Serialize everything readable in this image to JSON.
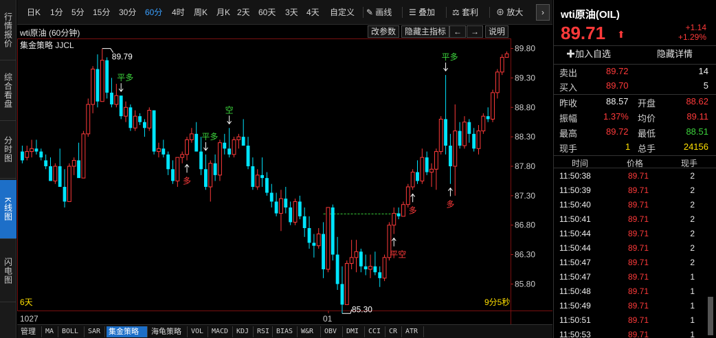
{
  "rail": {
    "tabs": [
      "行情报价",
      "综合看盘",
      "分时图",
      "K线图",
      "闪电图"
    ],
    "active": 3
  },
  "toolbar": {
    "periods": [
      "日K",
      "1分",
      "5分",
      "15分",
      "30分",
      "60分",
      "4时",
      "周K",
      "月K",
      "2天",
      "60天",
      "3天",
      "4天",
      "自定义"
    ],
    "active_period": "60分",
    "draw_label": "画线",
    "overlay_label": "叠加",
    "arbitrage_label": "套利",
    "zoom_label": "放大",
    "arrow": "›"
  },
  "chart_header": {
    "title": "wti原油 (60分钟)",
    "btn_params": "改参数",
    "btn_hide": "隐藏主指标",
    "btn_left": "←",
    "btn_right": "→",
    "btn_help": "说明",
    "strategy": "集金策略 JJCL"
  },
  "chart_data": {
    "type": "candlestick",
    "ylim": [
      85.35,
      89.97
    ],
    "yticks": [
      "89.80",
      "89.30",
      "88.80",
      "88.30",
      "87.80",
      "87.30",
      "86.80",
      "86.30",
      "85.80"
    ],
    "xlabels": [
      "1027",
      "01"
    ],
    "max_label": "89.79",
    "min_label": "85.30",
    "period_label": "6天",
    "countdown": "9分5秒",
    "guide_level": 86.99,
    "ohlc": [
      [
        88.05,
        88.15,
        87.85,
        87.9
      ],
      [
        87.95,
        88.15,
        87.9,
        88.05
      ],
      [
        88.05,
        88.25,
        87.95,
        88.1
      ],
      [
        88.1,
        88.25,
        88.0,
        88.05
      ],
      [
        88.05,
        88.1,
        87.9,
        87.95
      ],
      [
        87.9,
        88.0,
        87.75,
        87.8
      ],
      [
        87.8,
        87.95,
        87.55,
        87.55
      ],
      [
        87.55,
        87.85,
        87.5,
        87.8
      ],
      [
        87.8,
        88.1,
        87.45,
        87.45
      ],
      [
        87.45,
        87.75,
        87.1,
        87.2
      ],
      [
        87.2,
        87.85,
        87.2,
        87.8
      ],
      [
        87.8,
        87.95,
        87.65,
        87.9
      ],
      [
        87.9,
        88.2,
        87.8,
        87.6
      ],
      [
        87.6,
        88.4,
        87.6,
        88.35
      ],
      [
        88.35,
        88.95,
        88.3,
        88.85
      ],
      [
        88.85,
        89.5,
        88.7,
        89.45
      ],
      [
        89.45,
        89.7,
        88.8,
        88.9
      ],
      [
        88.9,
        89.8,
        88.9,
        89.6
      ],
      [
        89.6,
        89.65,
        88.95,
        89.05
      ],
      [
        89.05,
        89.3,
        88.8,
        88.85
      ],
      [
        88.85,
        89.2,
        88.8,
        89.0
      ],
      [
        89.0,
        89.0,
        88.6,
        88.65
      ],
      [
        88.65,
        88.9,
        88.55,
        88.8
      ],
      [
        88.8,
        88.85,
        88.4,
        88.45
      ],
      [
        88.45,
        88.75,
        88.4,
        88.65
      ],
      [
        88.65,
        88.7,
        88.5,
        88.55
      ],
      [
        88.55,
        88.6,
        88.3,
        88.45
      ],
      [
        88.45,
        88.8,
        88.4,
        88.75
      ],
      [
        88.75,
        88.75,
        88.0,
        88.05
      ],
      [
        88.05,
        88.2,
        87.95,
        88.1
      ],
      [
        88.1,
        88.25,
        87.95,
        88.0
      ],
      [
        88.0,
        88.05,
        87.65,
        87.75
      ],
      [
        87.75,
        87.9,
        87.5,
        87.55
      ],
      [
        87.55,
        87.95,
        87.45,
        87.95
      ],
      [
        87.95,
        88.05,
        87.85,
        88.0
      ],
      [
        88.0,
        88.3,
        87.9,
        88.25
      ],
      [
        88.25,
        88.45,
        88.2,
        88.35
      ],
      [
        88.35,
        88.55,
        88.05,
        88.05
      ],
      [
        88.05,
        88.3,
        87.65,
        87.75
      ],
      [
        87.75,
        88.0,
        87.4,
        87.45
      ],
      [
        87.45,
        87.9,
        87.2,
        87.85
      ],
      [
        87.85,
        88.0,
        87.55,
        87.65
      ],
      [
        87.65,
        88.25,
        87.55,
        88.2
      ],
      [
        88.2,
        88.35,
        88.0,
        88.1
      ],
      [
        88.1,
        88.45,
        87.95,
        88.0
      ],
      [
        88.0,
        88.3,
        87.95,
        88.25
      ],
      [
        88.25,
        88.35,
        88.1,
        88.3
      ],
      [
        88.3,
        88.6,
        88.2,
        88.15
      ],
      [
        88.15,
        88.3,
        87.75,
        87.8
      ],
      [
        87.8,
        87.95,
        87.4,
        87.45
      ],
      [
        87.45,
        87.75,
        87.4,
        87.65
      ],
      [
        87.65,
        87.95,
        87.45,
        87.6
      ],
      [
        87.6,
        87.7,
        87.3,
        87.35
      ],
      [
        87.35,
        87.5,
        87.1,
        87.2
      ],
      [
        87.2,
        87.35,
        86.95,
        87.0
      ],
      [
        87.0,
        87.4,
        86.7,
        87.25
      ],
      [
        87.25,
        87.45,
        87.0,
        87.1
      ],
      [
        87.1,
        87.2,
        86.8,
        86.85
      ],
      [
        86.85,
        87.25,
        86.8,
        87.2
      ],
      [
        87.2,
        87.3,
        86.9,
        86.95
      ],
      [
        86.95,
        87.1,
        86.6,
        86.75
      ],
      [
        86.75,
        86.95,
        86.4,
        86.5
      ],
      [
        86.5,
        86.65,
        86.25,
        86.45
      ],
      [
        86.45,
        86.75,
        86.4,
        86.65
      ],
      [
        86.65,
        86.85,
        85.9,
        86.05
      ],
      [
        86.05,
        87.0,
        86.0,
        87.1
      ],
      [
        87.1,
        87.15,
        86.2,
        86.3
      ],
      [
        86.3,
        86.6,
        85.7,
        85.8
      ],
      [
        85.8,
        86.1,
        85.3,
        85.45
      ],
      [
        85.45,
        86.2,
        85.45,
        86.15
      ],
      [
        86.15,
        86.55,
        86.05,
        86.25
      ],
      [
        86.25,
        86.55,
        86.0,
        86.35
      ],
      [
        86.35,
        86.4,
        86.0,
        86.1
      ],
      [
        86.1,
        86.3,
        85.95,
        86.05
      ],
      [
        86.05,
        86.3,
        85.9,
        86.1
      ],
      [
        86.1,
        86.35,
        85.95,
        86.0
      ],
      [
        86.0,
        86.1,
        85.75,
        85.9
      ],
      [
        85.9,
        86.3,
        85.85,
        86.25
      ],
      [
        86.25,
        86.85,
        86.2,
        86.8
      ],
      [
        86.8,
        87.1,
        86.65,
        87.0
      ],
      [
        87.0,
        87.1,
        86.9,
        86.95
      ],
      [
        86.95,
        87.2,
        86.95,
        87.15
      ],
      [
        87.15,
        87.5,
        87.1,
        87.45
      ],
      [
        87.45,
        87.75,
        87.4,
        87.7
      ],
      [
        87.7,
        87.9,
        87.5,
        87.55
      ],
      [
        87.55,
        88.1,
        87.5,
        87.95
      ],
      [
        87.95,
        88.05,
        87.65,
        87.7
      ],
      [
        87.7,
        87.85,
        87.45,
        87.75
      ],
      [
        87.75,
        88.1,
        87.4,
        88.05
      ],
      [
        88.05,
        88.65,
        88.0,
        88.6
      ],
      [
        88.6,
        89.35,
        88.0,
        88.15
      ],
      [
        88.15,
        88.35,
        87.5,
        87.8
      ],
      [
        87.8,
        88.85,
        87.3,
        88.4
      ],
      [
        88.4,
        88.55,
        88.1,
        88.15
      ],
      [
        88.15,
        88.65,
        88.1,
        88.55
      ],
      [
        88.55,
        88.6,
        88.2,
        88.35
      ],
      [
        88.35,
        88.45,
        88.05,
        88.1
      ],
      [
        88.1,
        88.5,
        88.0,
        88.4
      ],
      [
        88.4,
        88.7,
        88.35,
        88.65
      ],
      [
        88.65,
        88.8,
        88.55,
        88.6
      ],
      [
        88.6,
        89.1,
        88.55,
        89.05
      ],
      [
        89.05,
        89.45,
        88.95,
        89.4
      ],
      [
        89.4,
        89.7,
        89.35,
        89.65
      ],
      [
        89.65,
        89.75,
        89.65,
        89.71
      ]
    ],
    "signals": [
      {
        "i": 21,
        "label": "平多",
        "dir": "down",
        "color": "#3cd43c",
        "pos": "above"
      },
      {
        "i": 35,
        "label": "多",
        "dir": "up",
        "color": "#ff3a3a",
        "pos": "below"
      },
      {
        "i": 39,
        "label": "平多",
        "dir": "down",
        "color": "#3cd43c",
        "pos": "above"
      },
      {
        "i": 44,
        "label": "空",
        "dir": "down",
        "color": "#3cd43c",
        "pos": "above"
      },
      {
        "i": 79,
        "label": "平空",
        "dir": "up",
        "color": "#ff3a3a",
        "pos": "below"
      },
      {
        "i": 83,
        "label": "多",
        "dir": "up",
        "color": "#ff3a3a",
        "pos": "below"
      },
      {
        "i": 90,
        "label": "平多",
        "dir": "down",
        "color": "#3cd43c",
        "pos": "above"
      },
      {
        "i": 91,
        "label": "多",
        "dir": "up",
        "color": "#ff3a3a",
        "pos": "below"
      }
    ]
  },
  "quote": {
    "name": "wti原油(OIL)",
    "price": "89.71",
    "arrow": "⬆",
    "change": "+1.14",
    "change_pct": "+1.29%",
    "add_watch": "✚加入自选",
    "hide_detail": "隐藏详情",
    "sell_label": "卖出",
    "sell_price": "89.72",
    "sell_vol": "14",
    "buy_label": "买入",
    "buy_price": "89.70",
    "buy_vol": "5",
    "prev_close_label": "昨收",
    "prev_close": "88.57",
    "open_label": "开盘",
    "open": "88.62",
    "amp_label": "振幅",
    "amp": "1.37%",
    "avg_label": "均价",
    "avg": "89.11",
    "high_label": "最高",
    "high": "89.72",
    "low_label": "最低",
    "low": "88.51",
    "cur_vol_label": "现手",
    "cur_vol": "1",
    "total_vol_label": "总手",
    "total_vol": "24156",
    "col_time": "时间",
    "col_price": "价格",
    "col_vol": "现手",
    "trades": [
      {
        "time": "11:50:38",
        "price": "89.71",
        "vol": "2"
      },
      {
        "time": "11:50:39",
        "price": "89.71",
        "vol": "2"
      },
      {
        "time": "11:50:40",
        "price": "89.71",
        "vol": "2"
      },
      {
        "time": "11:50:41",
        "price": "89.71",
        "vol": "2"
      },
      {
        "time": "11:50:44",
        "price": "89.71",
        "vol": "2"
      },
      {
        "time": "11:50:44",
        "price": "89.71",
        "vol": "2"
      },
      {
        "time": "11:50:47",
        "price": "89.71",
        "vol": "2"
      },
      {
        "time": "11:50:47",
        "price": "89.71",
        "vol": "1"
      },
      {
        "time": "11:50:48",
        "price": "89.71",
        "vol": "1"
      },
      {
        "time": "11:50:49",
        "price": "89.71",
        "vol": "1"
      },
      {
        "time": "11:50:51",
        "price": "89.71",
        "vol": "1"
      },
      {
        "time": "11:50:53",
        "price": "89.71",
        "vol": "1"
      }
    ]
  },
  "bottom_tabs": [
    "管理",
    "MA",
    "BOLL",
    "SAR",
    "集金策略",
    "海龟策略",
    "VOL",
    "MACD",
    "KDJ",
    "RSI",
    "BIAS",
    "W&R",
    "OBV",
    "DMI",
    "CCI",
    "CR",
    "ATR"
  ],
  "bottom_active": "集金策略",
  "colors": {
    "up": "#ff3a3a",
    "down": "#00e5ff",
    "grid": "#7a1010",
    "accent": "#1d6fc8"
  }
}
